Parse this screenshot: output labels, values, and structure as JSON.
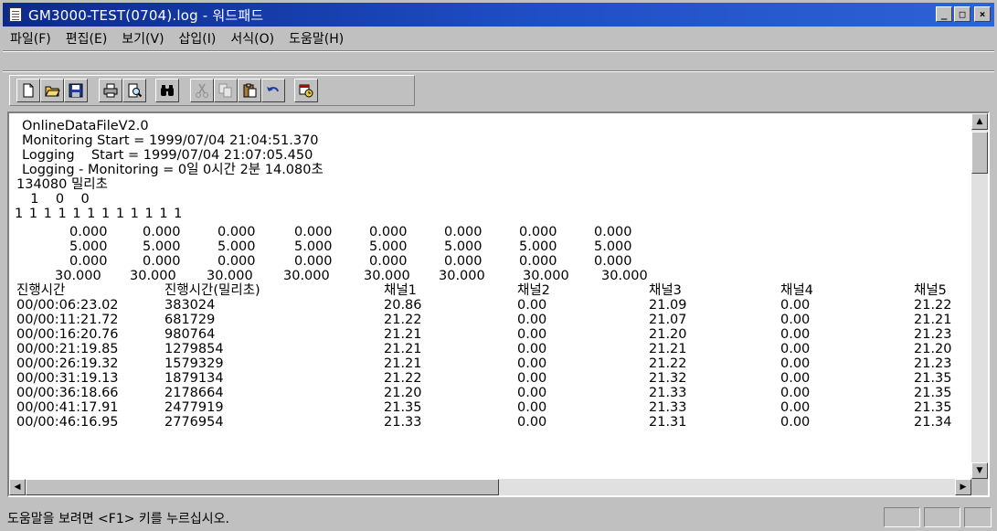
{
  "window": {
    "title": "GM3000-TEST(0704).log - 워드패드",
    "minimize_label": "_",
    "maximize_label": "□",
    "close_label": "×"
  },
  "menu": {
    "items": [
      "파일(F)",
      "편집(E)",
      "보기(V)",
      "삽입(I)",
      "서식(O)",
      "도움말(H)"
    ]
  },
  "toolbar": {
    "buttons": [
      "new-document-icon",
      "open-folder-icon",
      "save-icon",
      "print-icon",
      "print-preview-icon",
      "find-binoculars-icon",
      "cut-scissors-icon",
      "copy-icon",
      "paste-icon",
      "undo-icon",
      "date-time-icon"
    ]
  },
  "document": {
    "lines": [
      "OnlineDataFileV2.0",
      "Monitoring Start = 1999/07/04 21:04:51.370",
      "Logging    Start = 1999/07/04 21:07:05.450",
      "Logging - Monitoring = 0일 0시간 2분 14.080초",
      "134080 밀리초",
      "  1    0    0",
      "1 1 1 1 1 1 1 1 1 1 1 1"
    ],
    "range_rows": [
      [
        "0.000",
        "0.000",
        "0.000",
        "0.000",
        "0.000",
        "0.000",
        "0.000",
        "0.000"
      ],
      [
        "5.000",
        "5.000",
        "5.000",
        "5.000",
        "5.000",
        "5.000",
        "5.000",
        "5.000"
      ],
      [
        "0.000",
        "0.000",
        "0.000",
        "0.000",
        "0.000",
        "0.000",
        "0.000",
        "0.000"
      ],
      [
        "30.000",
        "30.000",
        "30.000",
        "30.000",
        "30.000",
        "30.000",
        "30.000",
        "30.000"
      ]
    ],
    "headers": [
      "진행시간",
      "진행시간(밀리초)",
      "채널1",
      "채널2",
      "채널3",
      "채널4",
      "채널5"
    ],
    "rows": [
      [
        "00/00:06:23.02",
        "383024",
        "20.86",
        "0.00",
        "21.09",
        "0.00",
        "21.22"
      ],
      [
        "00/00:11:21.72",
        "681729",
        "21.22",
        "0.00",
        "21.07",
        "0.00",
        "21.21"
      ],
      [
        "00/00:16:20.76",
        "980764",
        "21.21",
        "0.00",
        "21.20",
        "0.00",
        "21.23"
      ],
      [
        "00/00:21:19.85",
        "1279854",
        "21.21",
        "0.00",
        "21.21",
        "0.00",
        "21.20"
      ],
      [
        "00/00:26:19.32",
        "1579329",
        "21.21",
        "0.00",
        "21.22",
        "0.00",
        "21.23"
      ],
      [
        "00/00:31:19.13",
        "1879134",
        "21.22",
        "0.00",
        "21.32",
        "0.00",
        "21.35"
      ],
      [
        "00/00:36:18.66",
        "2178664",
        "21.20",
        "0.00",
        "21.33",
        "0.00",
        "21.35"
      ],
      [
        "00/00:41:17.91",
        "2477919",
        "21.35",
        "0.00",
        "21.33",
        "0.00",
        "21.35"
      ],
      [
        "00/00:46:16.95",
        "2776954",
        "21.33",
        "0.00",
        "21.31",
        "0.00",
        "21.34"
      ]
    ]
  },
  "status": {
    "text": "도움말을 보려면 <F1> 키를 누르십시오."
  }
}
